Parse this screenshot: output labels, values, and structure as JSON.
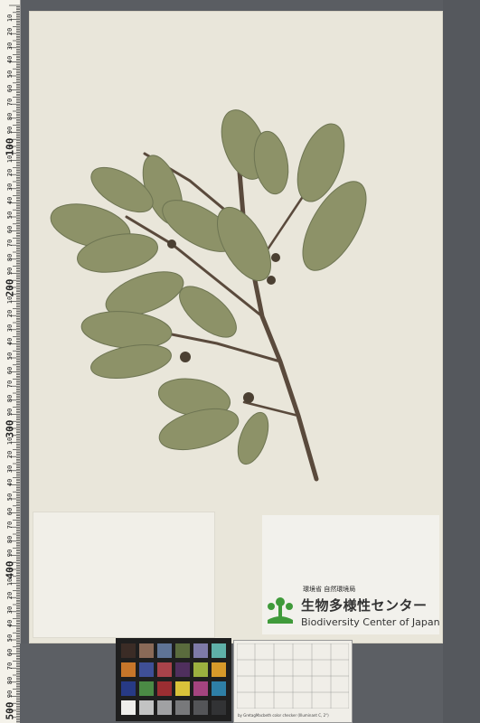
{
  "ruler": {
    "labels_big": [
      "100",
      "200",
      "300",
      "400",
      "500"
    ],
    "labels_small": [
      "10",
      "20",
      "30",
      "40",
      "50",
      "60",
      "70",
      "80",
      "90",
      "10",
      "20",
      "30",
      "40",
      "50",
      "60",
      "70",
      "80",
      "90",
      "10",
      "20",
      "30",
      "40",
      "50",
      "60",
      "70",
      "80",
      "90",
      "10",
      "20",
      "30",
      "40",
      "50",
      "60",
      "70",
      "80",
      "90",
      "10",
      "20",
      "30",
      "40",
      "50",
      "60",
      "70",
      "80",
      "90"
    ]
  },
  "logo": {
    "org": "環境省 自然環境局",
    "name_jp": "生物多様性センター",
    "name_en": "Biodiversity Center of Japan"
  },
  "color_checker": {
    "chips": [
      "#3b2c26",
      "#8a6a58",
      "#5f7496",
      "#5a6b3d",
      "#7e7aa8",
      "#5fb0a8",
      "#c7762a",
      "#3f4f96",
      "#a8434a",
      "#4f2f5d",
      "#9bb03f",
      "#d79a2a",
      "#273a85",
      "#4b8a45",
      "#9b2e32",
      "#d9c23a",
      "#a4447f",
      "#2e7fa6",
      "#eeeeec",
      "#c2c3c3",
      "#a0a1a3",
      "#78797b",
      "#545558",
      "#323335"
    ],
    "caption": "by GretagMacbeth color checker (Illuminant C, 2°)"
  },
  "colors": {
    "leaf": "#8d9268",
    "leaf_dark": "#6d7452",
    "stem": "#5a4a3c",
    "logo_green": "#3f9a3a"
  }
}
